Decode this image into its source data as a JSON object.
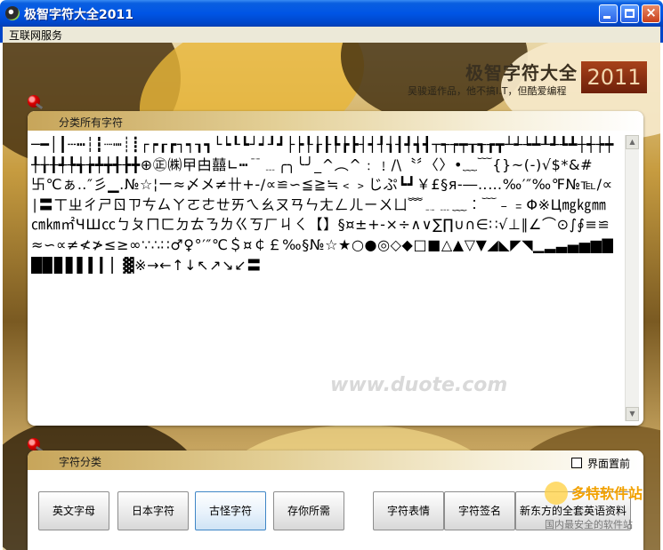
{
  "window": {
    "title": "极智字符大全2011",
    "minimize": "minimize",
    "maximize": "maximize",
    "close": "×"
  },
  "menu": {
    "items": [
      "互联网服务"
    ]
  },
  "banner": {
    "title": "极智字符大全",
    "subtitle": "吴骏遥作品，他不搞I.T，但酷爱编程",
    "year": "2011"
  },
  "chars_panel": {
    "title": "分类所有字符",
    "content": "─━│┃┄┅┆┇┈┉┊┋┌┍┎┏┐┑┒┓└┕┖┗┘┙┚┛├┝┞┟┠┡┢┣┤┥┦┧┨┩┪┫┬┭┮┯┰┱┲┳┴┵┶┷┸┹┺┻┼┽┾┿╀╁╂╃╄╅╆╇╈╉╊╋⊕㊣㈱曱甴囍∟┅﹊﹍╭╮╰╯_^︵^﹕﹗/\\〝〞〈〉•﹏﹋{}~(-)√$*&#卐℃ぁ‥″彡▁.№☆¦ー≈〆メ≠卄+-/∝≌∽≦≧≒﹤﹥じぷ┗┛￥£§я-―‥…‰′″‰℉№℡∕∝∣〓ㄒㄓㄔㄕㄖㄗㄘㄙㄚㄛㄜㄝㄞㄟㄠㄡㄢㄣㄤㄥㄦㄧㄨㄩ﹌﹎﹍﹏︰﹋﹣﹦Φ※Ц㎎㎏㎜㎝㎞㎡ЧШ㏄ㄅㄆㄇㄈㄉㄊㄋㄌㄍㄎㄏㄐㄑ【】§¤±+-×÷∧∨∑∏∪∩∈∷√⊥∥∠⌒⊙∫∮≡≌≈∽∝≠≮≯≤≥∞∵∴∷♂♀°′″℃＄¤￠￡‰§№☆★○●◎◇◆□■△▲▽▼◢◣◤◥▁▂▃▄▅▆▇█▉▊▋▌▍▎▏▓※→←↑↓↖↗↘↙〓"
  },
  "categories_panel": {
    "title": "字符分类",
    "topmost_label": "界面置前",
    "buttons": [
      "英文字母",
      "日本字符",
      "古怪字符",
      "存你所需",
      "字符表情",
      "字符签名",
      "新东方的全套英语资料"
    ]
  },
  "watermark": {
    "name": "多特软件站",
    "tag": "国内最安全的软件站",
    "center": "www.duote.com"
  },
  "colors": {
    "titlebar": "#0055e5",
    "menubar": "#ece9d8",
    "panel_header": "#e3cf96",
    "active_button_border": "#3f86c6"
  }
}
